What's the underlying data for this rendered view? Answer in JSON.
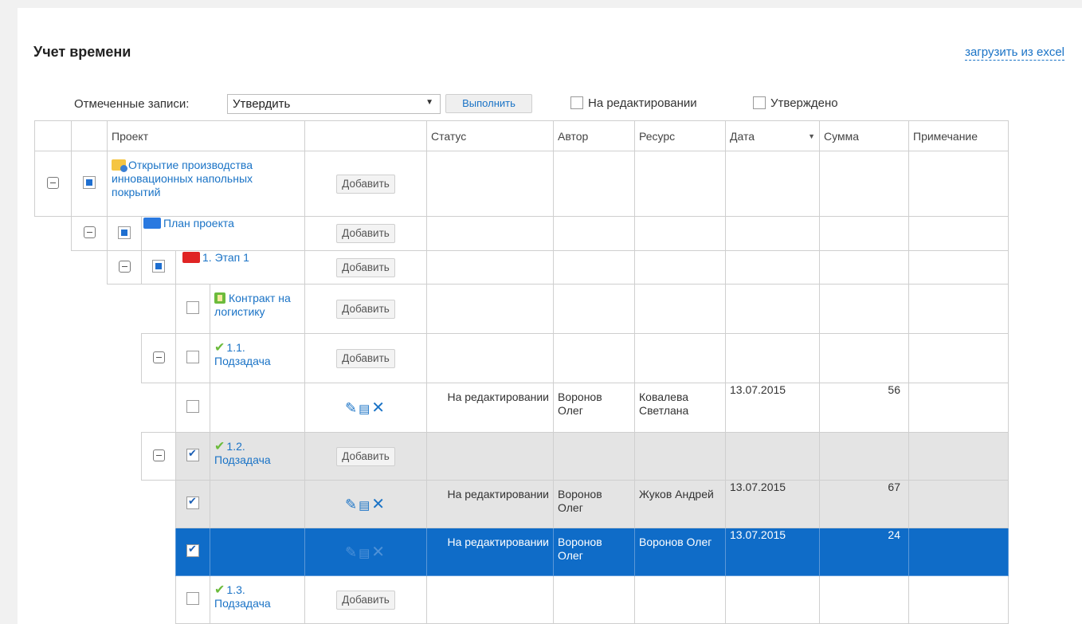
{
  "page": {
    "title": "Учет времени",
    "excel_link": "загрузить из excel"
  },
  "toolbar": {
    "marked_label": "Отмеченные записи:",
    "action_value": "Утвердить",
    "execute_label": "Выполнить",
    "filter_editing": "На редактировании",
    "filter_approved": "Утверждено"
  },
  "columns": {
    "project": "Проект",
    "status": "Статус",
    "author": "Автор",
    "resource": "Ресурс",
    "date": "Дата",
    "sum": "Сумма",
    "note": "Примечание"
  },
  "add_label": "Добавить",
  "tree": {
    "project": "Открытие производства инновационных напольных покрытий",
    "plan": "План проекта",
    "stage": "1. Этап 1",
    "contract": "Контракт на логистику",
    "task1": "1.1. Подзадача",
    "task2": "1.2. Подзадача",
    "task3": "1.3. Подзадача"
  },
  "entries": [
    {
      "status": "На редактировании",
      "author": "Воронов Олег",
      "resource": "Ковалева Светлана",
      "date": "13.07.2015",
      "sum": "56"
    },
    {
      "status": "На редактировании",
      "author": "Воронов Олег",
      "resource": "Жуков Андрей",
      "date": "13.07.2015",
      "sum": "67"
    },
    {
      "status": "На редактировании",
      "author": "Воронов Олег",
      "resource": "Воронов Олег",
      "date": "13.07.2015",
      "sum": "24"
    }
  ],
  "icons": {
    "project_folder": "project-folder-icon",
    "plan_folder": "blue-folder-icon",
    "stage_folder": "red-folder-icon",
    "contract": "contract-icon",
    "task_check": "green-check-icon",
    "edit": "pencil-icon",
    "details": "document-icon",
    "delete": "x-icon"
  },
  "colors": {
    "link": "#1a73c6",
    "selected_row": "#0f6cc8",
    "checked_row": "#e4e4e4"
  }
}
